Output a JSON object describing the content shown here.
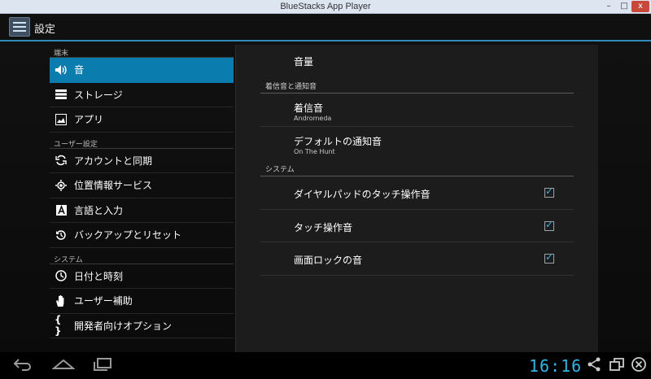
{
  "window": {
    "title": "BlueStacks App Player",
    "min_glyph": "–",
    "max_glyph": "□",
    "close_glyph": "x"
  },
  "actionbar": {
    "title": "設定",
    "icon": "settings-app-icon"
  },
  "sidebar": {
    "sections": [
      {
        "header": "端末",
        "items": [
          {
            "label": "音",
            "icon": "speaker-icon",
            "glyph": "🔊",
            "active": true
          },
          {
            "label": "ストレージ",
            "icon": "storage-icon",
            "glyph": "☰"
          },
          {
            "label": "アプリ",
            "icon": "apps-icon",
            "glyph": "▣"
          }
        ]
      },
      {
        "header": "ユーザー設定",
        "items": [
          {
            "label": "アカウントと同期",
            "icon": "sync-icon",
            "glyph": "⟳"
          },
          {
            "label": "位置情報サービス",
            "icon": "location-icon",
            "glyph": "◎"
          },
          {
            "label": "言語と入力",
            "icon": "language-icon",
            "glyph": "A"
          },
          {
            "label": "バックアップとリセット",
            "icon": "backup-icon",
            "glyph": "↺"
          }
        ]
      },
      {
        "header": "システム",
        "items": [
          {
            "label": "日付と時刻",
            "icon": "clock-icon",
            "glyph": "◷"
          },
          {
            "label": "ユーザー補助",
            "icon": "hand-icon",
            "glyph": "✋"
          },
          {
            "label": "開発者向けオプション",
            "icon": "braces-icon",
            "glyph": "{ }"
          }
        ]
      }
    ]
  },
  "detail": {
    "volume": "音量",
    "ringtone_section": "着信音と通知音",
    "ringtone": {
      "title": "着信音",
      "value": "Andromeda"
    },
    "notification": {
      "title": "デフォルトの通知音",
      "value": "On The Hunt"
    },
    "system_section": "システム",
    "toggles": [
      {
        "label": "ダイヤルパッドのタッチ操作音",
        "checked": true
      },
      {
        "label": "タッチ操作音",
        "checked": true
      },
      {
        "label": "画面ロックの音",
        "checked": true
      }
    ]
  },
  "navbar": {
    "back_icon": "back-icon",
    "home_icon": "home-icon",
    "recent_icon": "recent-apps-icon",
    "clock": "16:16",
    "share_icon": "share-icon",
    "window_icon": "window-icon",
    "close_icon": "close-icon"
  },
  "colors": {
    "accent": "#33b5e5",
    "selected": "#0a7cad",
    "chrome": "#dde6f0"
  }
}
